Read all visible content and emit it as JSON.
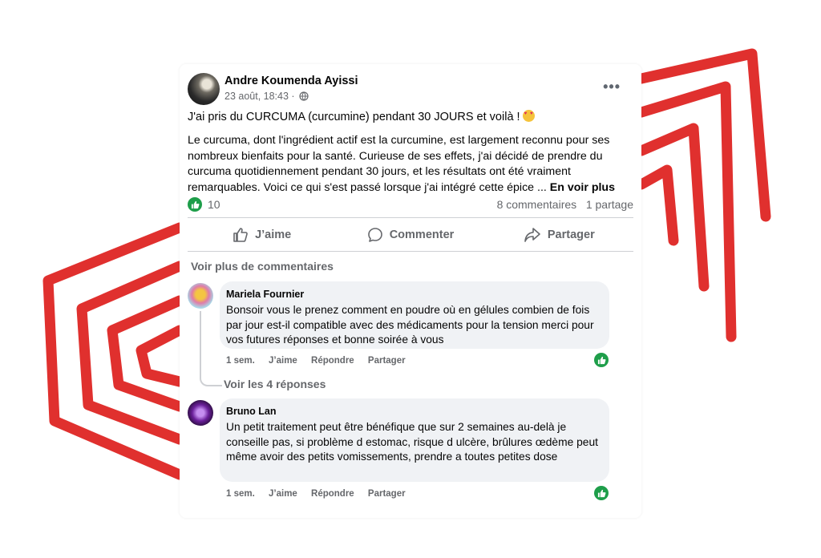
{
  "post": {
    "author": "Andre Koumenda Ayissi",
    "timestamp": "23 août, 18:43",
    "separator": "·",
    "audience_icon": "globe-icon",
    "menu_icon": "more-options-icon",
    "title_line": "J'ai pris du CURCUMA (curcumine) pendant 30 JOURS et voilà !",
    "title_emoji": "heart-eyes-emoji",
    "body": "Le curcuma, dont l'ingrédient actif est la curcumine, est largement reconnu pour ses nombreux bienfaits pour la santé. Curieuse de ses effets, j'ai décidé de prendre du curcuma quotidiennement pendant 30 jours, et les résultats ont été vraiment remarquables. Voici ce qui s'est passé lorsque j'ai intégré cette épice ...",
    "see_more": "En voir plus"
  },
  "reactions": {
    "count": "10",
    "comments": "8 commentaires",
    "shares": "1 partage",
    "icon": "thumbs-up-icon",
    "color": "#1e9e4a"
  },
  "actions": {
    "like": "J’aime",
    "comment": "Commenter",
    "share": "Partager"
  },
  "comments_section": {
    "more_comments": "Voir plus de commentaires",
    "view_replies": "Voir les 4 réponses",
    "items": [
      {
        "name": "Mariela Fournier",
        "text": "Bonsoir vous le prenez comment en poudre où en gélules combien de fois par jour est-il compatible avec des médicaments pour la tension merci pour vos futures réponses et bonne soirée à vous",
        "age": "1 sem.",
        "like": "J’aime",
        "reply": "Répondre",
        "share": "Partager"
      },
      {
        "name": "Bruno Lan",
        "text": "Un petit traitement peut être bénéfique que sur 2 semaines au-delà je conseille pas, si problème d estomac, risque d ulcère, brûlures œdème peut même avoir des petits vomissements, prendre a toutes petites dose",
        "age": "1 sem.",
        "like": "J’aime",
        "reply": "Répondre",
        "share": "Partager"
      }
    ]
  },
  "colors": {
    "decoration": "#e0302e",
    "secondary_text": "#65676b",
    "bubble": "#f0f2f5"
  }
}
